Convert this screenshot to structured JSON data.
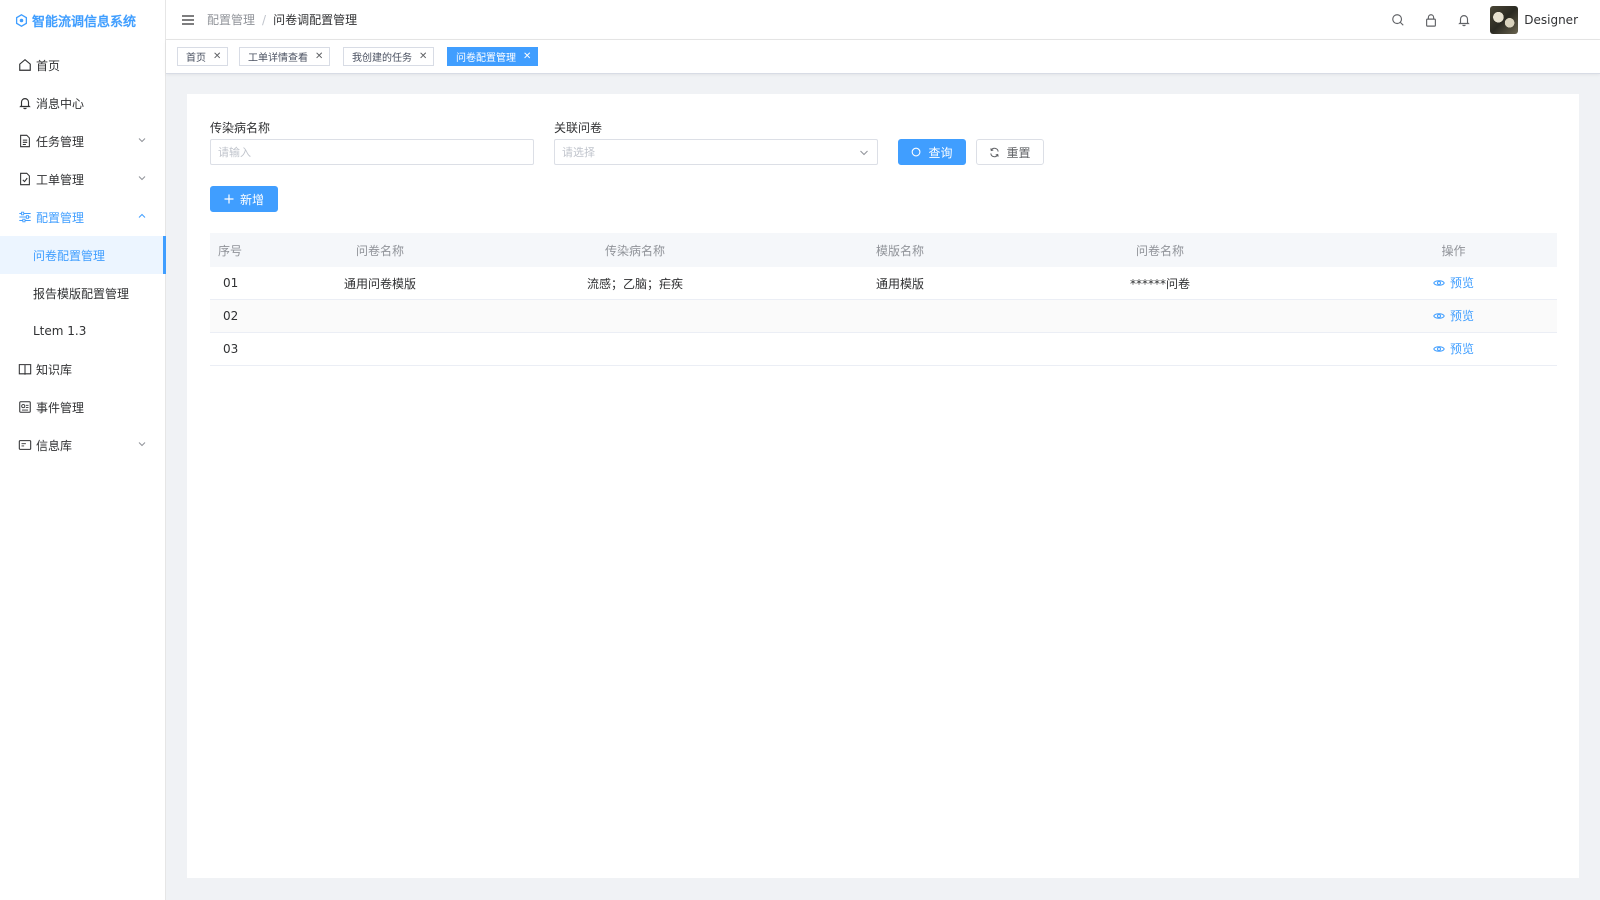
{
  "app": {
    "title": "智能流调信息系统"
  },
  "sidebar": {
    "items": [
      {
        "label": "首页",
        "icon": "home-icon"
      },
      {
        "label": "消息中心",
        "icon": "bell-icon"
      },
      {
        "label": "任务管理",
        "icon": "document-icon",
        "has_children": true
      },
      {
        "label": "工单管理",
        "icon": "checked-doc-icon",
        "has_children": true
      },
      {
        "label": "配置管理",
        "icon": "sliders-icon",
        "has_children": true,
        "expanded": true,
        "children": [
          {
            "label": "问卷配置管理",
            "active": true
          },
          {
            "label": "报告模版配置管理"
          },
          {
            "label": "Ltem 1.3"
          }
        ]
      },
      {
        "label": "知识库",
        "icon": "book-icon"
      },
      {
        "label": "事件管理",
        "icon": "event-icon"
      },
      {
        "label": "信息库",
        "icon": "card-icon",
        "has_children": true
      }
    ]
  },
  "header": {
    "breadcrumb": [
      "配置管理",
      "问卷调配置管理"
    ],
    "user_name": "Designer"
  },
  "tags": [
    {
      "label": "首页"
    },
    {
      "label": "工单详情查看"
    },
    {
      "label": "我创建的任务"
    },
    {
      "label": "问卷配置管理",
      "active": true
    }
  ],
  "filters": {
    "disease_label": "传染病名称",
    "disease_placeholder": "请输入",
    "questionnaire_label": "关联问卷",
    "questionnaire_placeholder": "请选择",
    "search_button": "查询",
    "reset_button": "重置",
    "add_button": "新增"
  },
  "table": {
    "columns": [
      "序号",
      "问卷名称",
      "传染病名称",
      "模版名称",
      "问卷名称",
      "操作"
    ],
    "rows": [
      {
        "index": "01",
        "name": "通用问卷模版",
        "disease": "流感；乙脑；疟疾",
        "template": "通用模版",
        "questionnaire": "******问卷",
        "action": "预览"
      },
      {
        "index": "02",
        "name": "",
        "disease": "",
        "template": "",
        "questionnaire": "",
        "action": "预览"
      },
      {
        "index": "03",
        "name": "",
        "disease": "",
        "template": "",
        "questionnaire": "",
        "action": "预览"
      }
    ]
  },
  "colors": {
    "primary": "#409eff",
    "text": "#303133",
    "muted": "#909399"
  }
}
